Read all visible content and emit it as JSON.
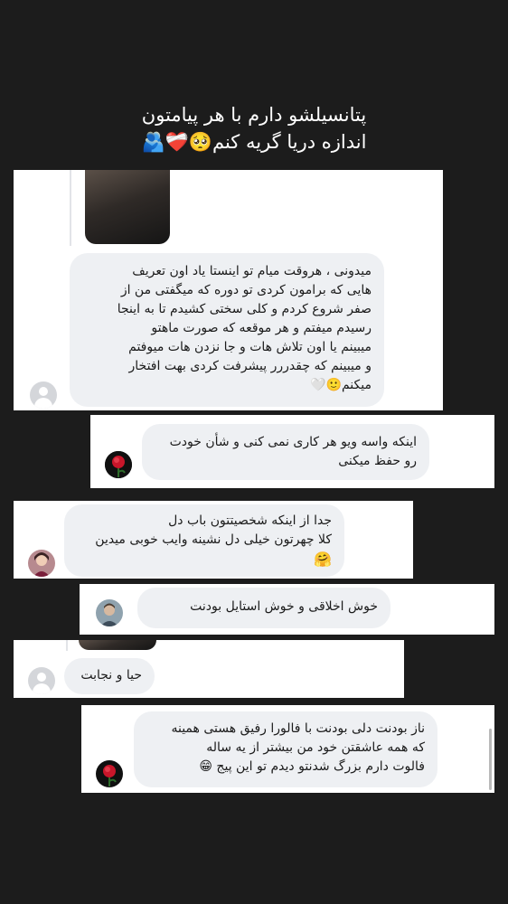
{
  "story": {
    "caption_line1": "پتانسیلشو دارم با هر پیامتون",
    "caption_line2": "اندازه دریا گریه کنم🥺❤️‍🩹🫂"
  },
  "comments": [
    {
      "lines": [
        "میدونی  ، هروقت میام تو اینستا یاد اون تعریف",
        "هایی که برامون کردی تو دوره که میگفتی من از",
        "صفر شروع کردم و کلی سختی کشیدم تا به اینجا",
        "رسیدم میفتم و هر موقعه که صورت ماهتو",
        "میبینم یا اون تلاش هات و جا نزدن هات میوفتم",
        "و میبینم که چقدررر پیشرفت کردی بهت افتخار",
        "میکنم🙂🤍"
      ],
      "avatar": "placeholder-avatar"
    },
    {
      "lines": [
        "اینکه واسه ویو هر کاری نمی کنی و شأن خودت",
        "رو حفظ میکنی"
      ],
      "avatar": "rose-avatar"
    },
    {
      "lines": [
        "جدا از اینکه شخصیتتون باب دل",
        "کلا چهرتون خیلی دل نشینه  وایب خوبی میدین",
        "🤗"
      ],
      "avatar": "girl-avatar"
    },
    {
      "lines": [
        "خوش اخلاقی و خوش استایل بودنت"
      ],
      "avatar": "man-avatar"
    },
    {
      "lines": [
        "حیا و نجابت"
      ],
      "avatar": "placeholder-avatar"
    },
    {
      "lines": [
        "ناز بودنت دلی بودنت با فالورا رفیق هستی همینه",
        "که همه عاشقتن خود من  بیشتر از یه ساله",
        "فالوت دارم بزرگ شدنتو دیدم تو این پیج 😁"
      ],
      "avatar": "rose-avatar"
    }
  ],
  "colors": {
    "background": "#1c1c1c",
    "card": "#ffffff",
    "bubble": "#eef0f3",
    "text": "#1b1b1b"
  }
}
